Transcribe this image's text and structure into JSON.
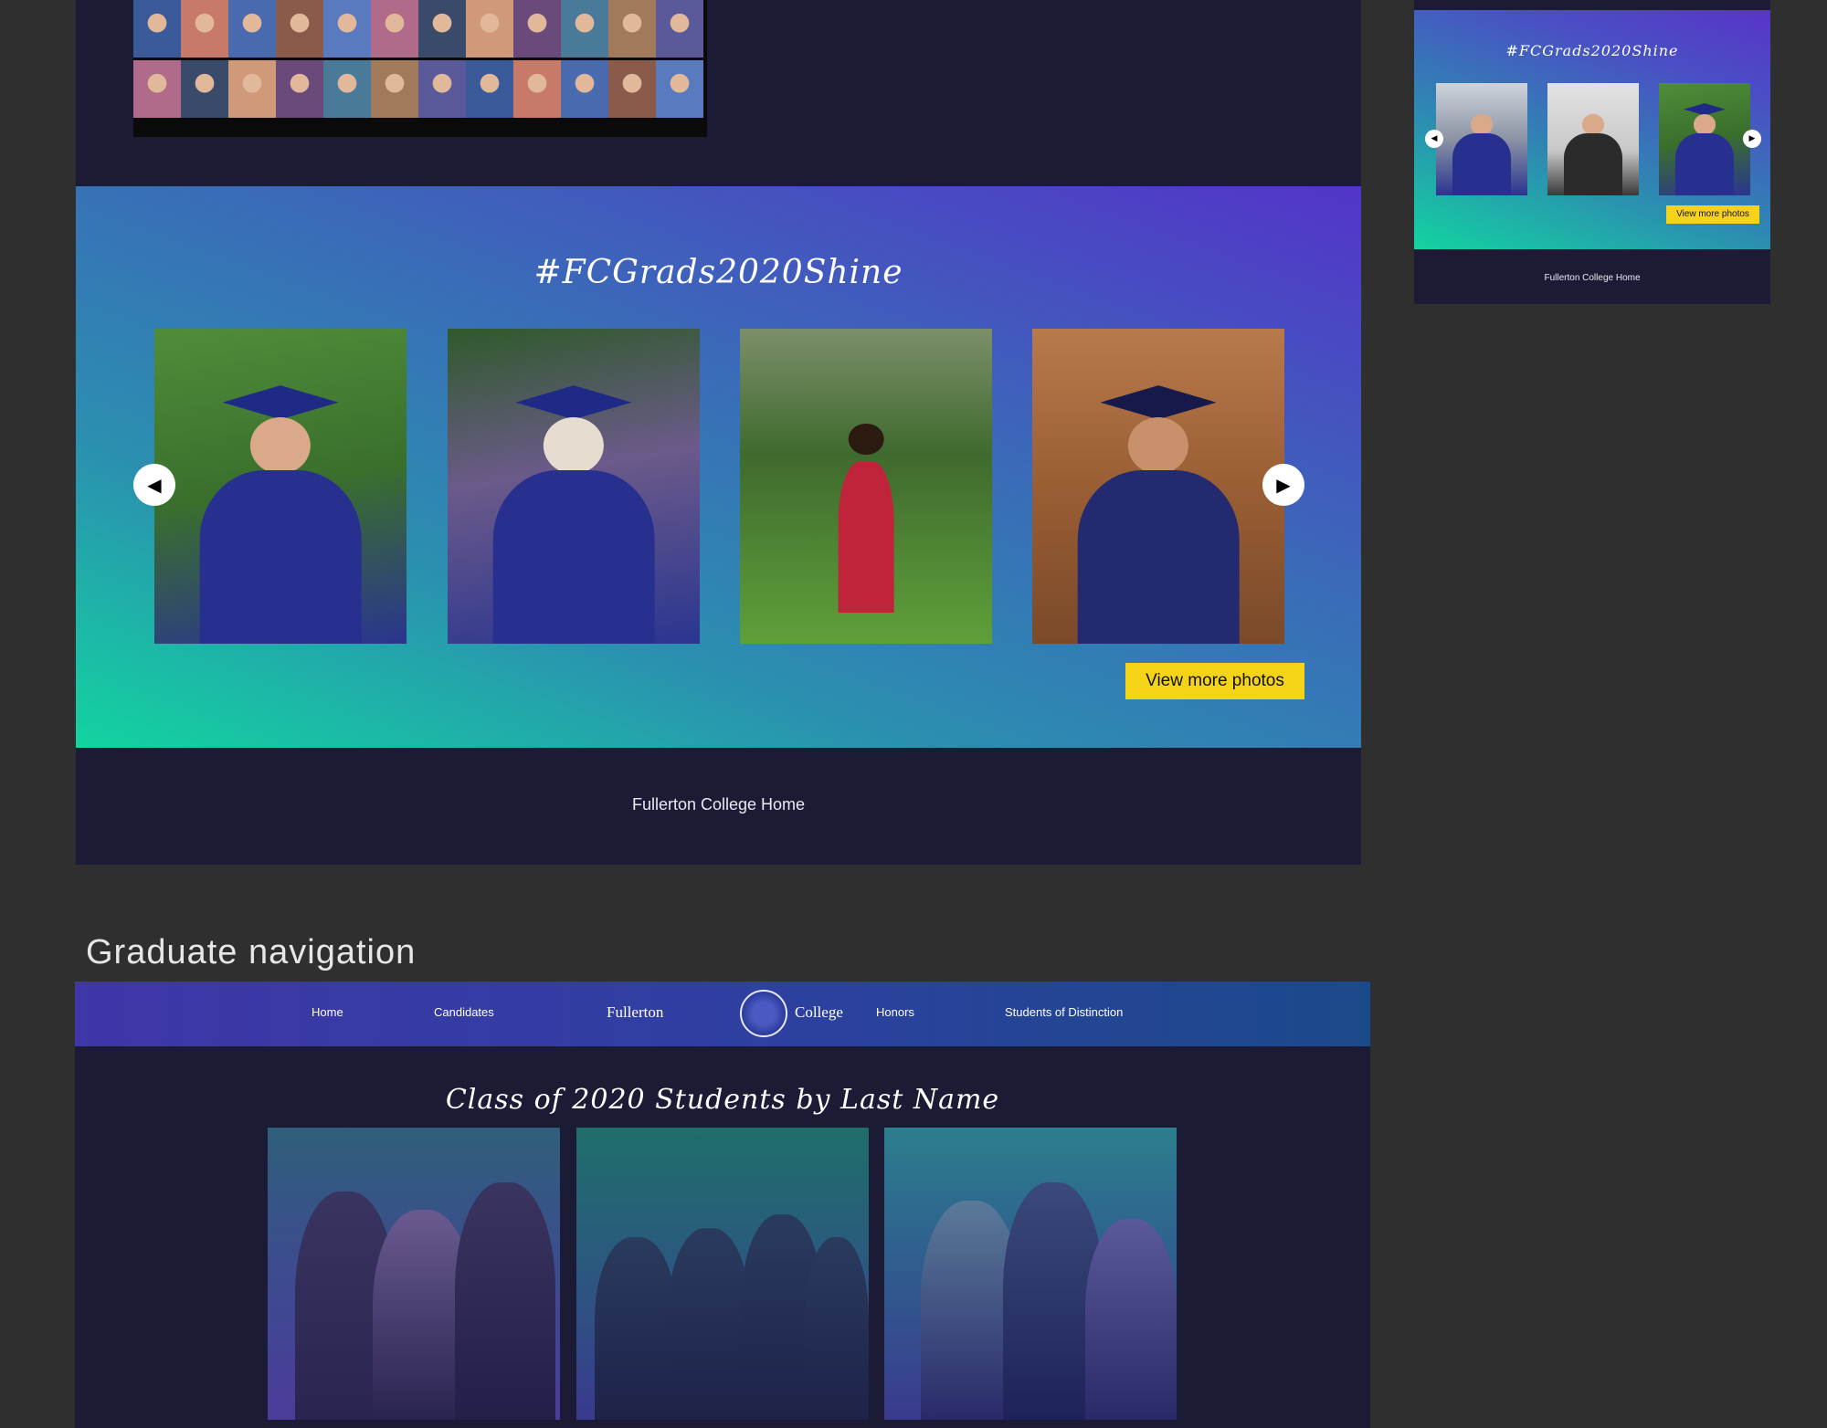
{
  "main_page": {
    "hashtag_title": "#FCGrads2020Shine",
    "prev_arrow_icon": "chevron-left-icon",
    "next_arrow_icon": "chevron-right-icon",
    "view_more_label": "View more photos",
    "footer_link": "Fullerton College Home"
  },
  "mobile_page": {
    "hashtag_title": "#FCGrads2020Shine",
    "view_more_label": "View more photos",
    "footer_link": "Fullerton College Home"
  },
  "section_label": "Graduate navigation",
  "graduate_page": {
    "nav": {
      "home": "Home",
      "candidates": "Candidates",
      "logo_left": "Fullerton",
      "logo_right": "College",
      "honors": "Honors",
      "students_of_distinction": "Students of Distinction"
    },
    "heading": "Class of 2020 Students by Last Name"
  },
  "colors": {
    "page_bg": "#2f2f2f",
    "site_bg": "#1b1b36",
    "accent_yellow": "#f5d417",
    "gradient_teal": "#12d4a0",
    "gradient_purple": "#5334c9"
  }
}
